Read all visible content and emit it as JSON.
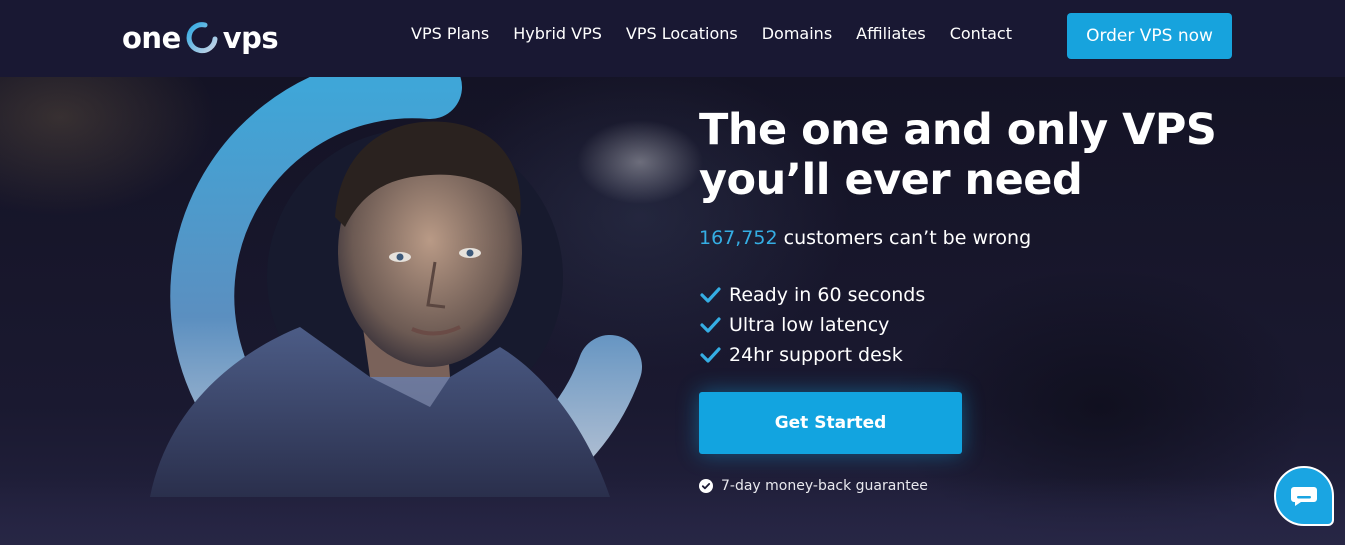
{
  "brand": {
    "logo_left": "one",
    "logo_right": "vps",
    "accent": "#17a3dd",
    "nav_bg": "#191833"
  },
  "nav": {
    "links": [
      "VPS Plans",
      "Hybrid VPS",
      "VPS Locations",
      "Domains",
      "Affiliates",
      "Contact"
    ],
    "order_label": "Order VPS now"
  },
  "hero": {
    "headline": "The one and only VPS you’ll ever need",
    "customer_count": "167,752",
    "tagline_rest": " customers can’t be wrong",
    "features": [
      "Ready in 60 seconds",
      "Ultra low latency",
      "24hr support desk"
    ],
    "cta_label": "Get Started",
    "guarantee": "7-day money-back guarantee"
  },
  "icons": {
    "check": "check-icon",
    "guarantee": "check-circle-icon",
    "chat": "chat-bubble-icon"
  }
}
